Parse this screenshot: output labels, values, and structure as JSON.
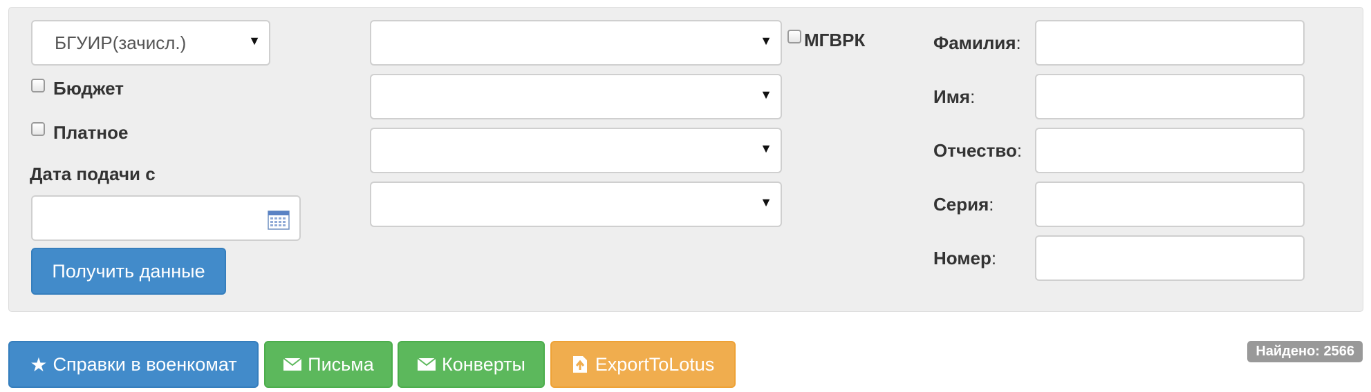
{
  "filters": {
    "university_select": {
      "value": "БГУИР(зачисл.)"
    },
    "checkbox_budget": {
      "label": "Бюджет",
      "checked": false
    },
    "checkbox_paid": {
      "label": "Платное",
      "checked": false
    },
    "checkbox_mgvrk": {
      "label": "МГВРК",
      "checked": false
    },
    "date_from": {
      "label": "Дата подачи с",
      "value": ""
    },
    "dropdowns": [
      {
        "value": ""
      },
      {
        "value": ""
      },
      {
        "value": ""
      },
      {
        "value": ""
      }
    ],
    "get_data_button": "Получить данные"
  },
  "person": {
    "surname_label": "Фамилия",
    "name_label": "Имя",
    "patronymic_label": "Отчество",
    "series_label": "Серия",
    "number_label": "Номер",
    "colon": ":"
  },
  "actions": {
    "military_refs": "Справки в военкомат",
    "letters": "Письма",
    "envelopes": "Конверты",
    "export_lotus": "ExportToLotus"
  },
  "found_badge": "Найдено: 2566",
  "icons": {
    "military_refs": "star-icon",
    "letters": "envelope-icon",
    "envelopes": "envelope-icon",
    "export_lotus": "export-file-icon",
    "date_picker": "calendar-icon",
    "dropdown": "caret-down-icon"
  },
  "colors": {
    "primary": "#428bca",
    "success": "#5cb85c",
    "warning": "#f0ad4e",
    "badge": "#999999",
    "panel": "#eeeeee"
  }
}
